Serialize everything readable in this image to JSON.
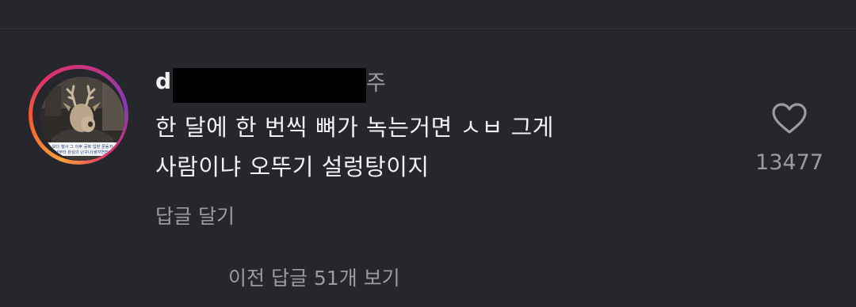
{
  "comment": {
    "username_visible": "d",
    "time_suffix": "주",
    "text": "한 달에 한 번씩 뼈가 녹는거면 ㅅㅂ 그게\n사람이냐 오뚜기 설렁탕이지",
    "reply_label": "답글 달기",
    "like_count": "13477",
    "like_icon": "heart-outline-icon",
    "avatar_caption": "보다 행사 그 이후 공복 입장 문동지\n생부터 관심의 난구나(생각연습)",
    "story_ring_colors": [
      "#f9a13a",
      "#f5612f",
      "#e1306c",
      "#c13584",
      "#833ab4"
    ]
  },
  "replies": {
    "view_label": "이전 답글 51개 보기"
  },
  "colors": {
    "background": "#25272c",
    "primary_text": "#f2f2f2",
    "secondary_text": "#9a9ca3",
    "redaction": "#000000"
  }
}
